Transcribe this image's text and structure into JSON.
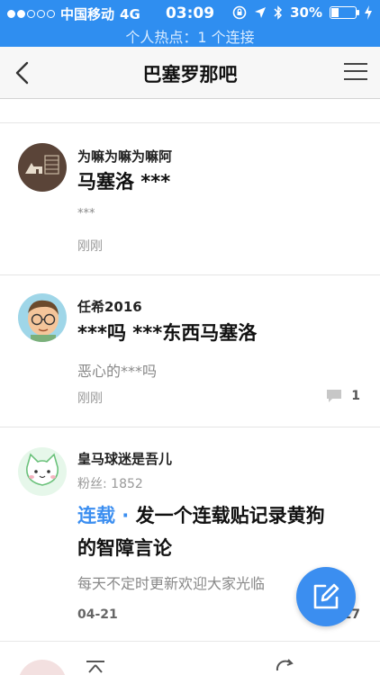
{
  "status_bar": {
    "carrier": "中国移动",
    "network": "4G",
    "time": "03:09",
    "battery": "30%",
    "battery_level": 0.3,
    "hotspot": "个人热点：1 个连接"
  },
  "nav": {
    "title": "巴塞罗那吧",
    "back_icon": "chevron-left-icon",
    "menu_icon": "hamburger-menu-icon"
  },
  "posts": [
    {
      "user": "为嘛为嘛为嘛阿",
      "title": "马塞洛 ***",
      "desc": "***",
      "time": "刚刚",
      "comments": ""
    },
    {
      "user": "任希2016",
      "title": "***吗 ***东西马塞洛",
      "desc": "恶心的***吗",
      "time": "刚刚",
      "comments": "1"
    },
    {
      "user": "皇马球迷是吾儿",
      "fans": "粉丝: 1852",
      "tag": "连载",
      "tag_sep": " · ",
      "title_line1": "发一个连载贴记录黄狗",
      "title_line2": "的智障言论",
      "desc": "每天不定时更新欢迎大家光临",
      "time": "04-21",
      "comments": "17"
    }
  ],
  "fab": {
    "icon": "compose-icon"
  },
  "colors": {
    "accent": "#3b8ef0",
    "status_bar": "#2f8ef0"
  }
}
